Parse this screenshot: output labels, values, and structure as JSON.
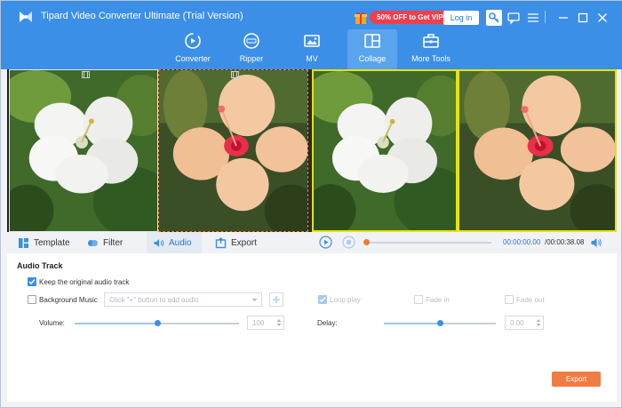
{
  "app": {
    "title": "Tipard Video Converter Ultimate (Trial Version)",
    "promo": "50% OFF to Get VIP",
    "login_label": "Log in",
    "icons": [
      "app-logo",
      "gift-icon",
      "key-icon",
      "feedback-icon",
      "menu-icon",
      "minimize-icon",
      "maximize-icon",
      "close-icon"
    ]
  },
  "nav": {
    "items": [
      {
        "label": "Converter",
        "icon": "converter-icon"
      },
      {
        "label": "Ripper",
        "icon": "ripper-icon"
      },
      {
        "label": "MV",
        "icon": "mv-icon"
      },
      {
        "label": "Collage",
        "icon": "collage-icon",
        "active": true
      },
      {
        "label": "More Tools",
        "icon": "toolbox-icon"
      }
    ]
  },
  "tabs": {
    "items": [
      {
        "label": "Template",
        "icon": "template-icon"
      },
      {
        "label": "Filter",
        "icon": "filter-icon"
      },
      {
        "label": "Audio",
        "icon": "audio-icon",
        "active": true
      },
      {
        "label": "Export",
        "icon": "export-icon"
      }
    ]
  },
  "player": {
    "current_time": "00:00:00.00",
    "total_time": "/00:00:38.08",
    "progress": 0.0
  },
  "audio": {
    "section_title": "Audio Track",
    "keep_original_label": "Keep the original audio track",
    "keep_original_checked": true,
    "background_music_label": "Background Music",
    "background_music_checked": false,
    "select_placeholder": "Click \"+\" button to add audio",
    "loop_play_label": "Loop play",
    "loop_play_checked": true,
    "fade_in_label": "Fade in",
    "fade_out_label": "Fade out",
    "volume_label": "Volume:",
    "volume_value": "100",
    "volume_level": 0.5,
    "delay_label": "Delay:",
    "delay_value": "0.00",
    "delay_level": 0.5
  },
  "export_label": "Export",
  "colors": {
    "accent": "#3c8fe6",
    "promo": "#ef3f4d",
    "export": "#f07c43",
    "selection": "#e6e20f"
  }
}
